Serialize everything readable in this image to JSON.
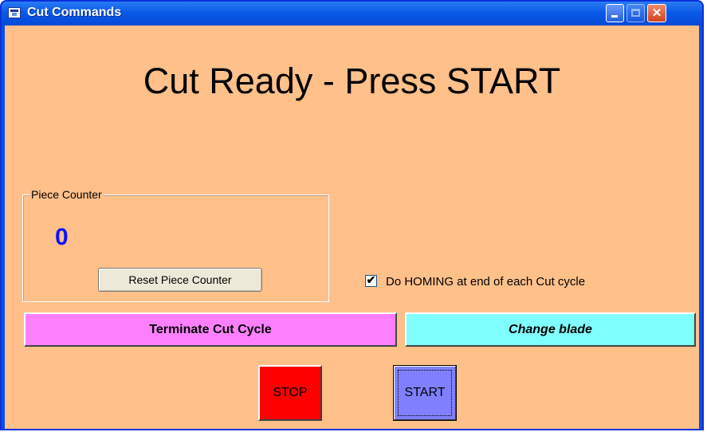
{
  "window": {
    "title": "Cut Commands",
    "controls": [
      "minimize",
      "maximize",
      "close"
    ],
    "close_glyph": "✕"
  },
  "headline": "Cut Ready - Press START",
  "piece_counter": {
    "legend": "Piece Counter",
    "value": "0",
    "reset_label": "Reset Piece Counter"
  },
  "homing_option": {
    "label": "Do HOMING at end of each Cut cycle",
    "checked": true,
    "check_glyph": "✔"
  },
  "buttons": {
    "terminate": "Terminate Cut Cycle",
    "change_blade": "Change blade",
    "stop": "STOP",
    "start": "START"
  },
  "colors": {
    "client_bg": "#ffc08a",
    "terminate_bg": "#ff80ff",
    "change_blade_bg": "#80ffff",
    "stop_bg": "#ff0000",
    "start_bg": "#8080ff",
    "counter_text": "#1010ff"
  }
}
